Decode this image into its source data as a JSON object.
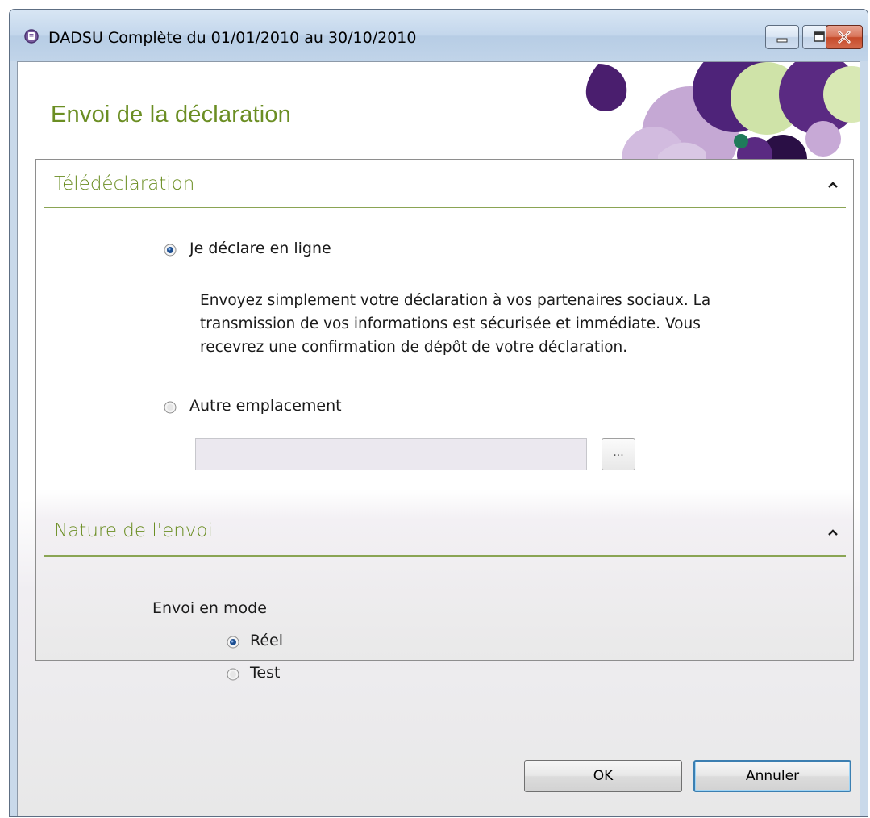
{
  "window": {
    "title": "DADSU Complète du 01/01/2010 au 30/10/2010",
    "controls": [
      "minimize",
      "maximize",
      "close"
    ]
  },
  "header": {
    "title": "Envoi de la déclaration"
  },
  "teledeclaration": {
    "title": "Télédéclaration",
    "option_online": {
      "label": "Je déclare en ligne",
      "selected": true,
      "description": "Envoyez simplement votre déclaration à vos partenaires sociaux. La transmission de vos informations est sécurisée et immédiate. Vous recevrez une confirmation de dépôt de votre déclaration."
    },
    "option_other": {
      "label": "Autre emplacement",
      "selected": false,
      "path_value": "",
      "browse_label": "..."
    }
  },
  "nature": {
    "title": "Nature de l'envoi",
    "mode_label": "Envoi en mode",
    "options": [
      {
        "label": "Réel",
        "selected": true
      },
      {
        "label": "Test",
        "selected": false
      }
    ]
  },
  "footer": {
    "ok_label": "OK",
    "cancel_label": "Annuler"
  },
  "colors": {
    "accent_green": "#6b8e23",
    "rule_green": "#8aa454",
    "deco_purple": "#5a2a82",
    "deco_lilac": "#c7a9d6",
    "deco_lime": "#cfe3a8"
  }
}
